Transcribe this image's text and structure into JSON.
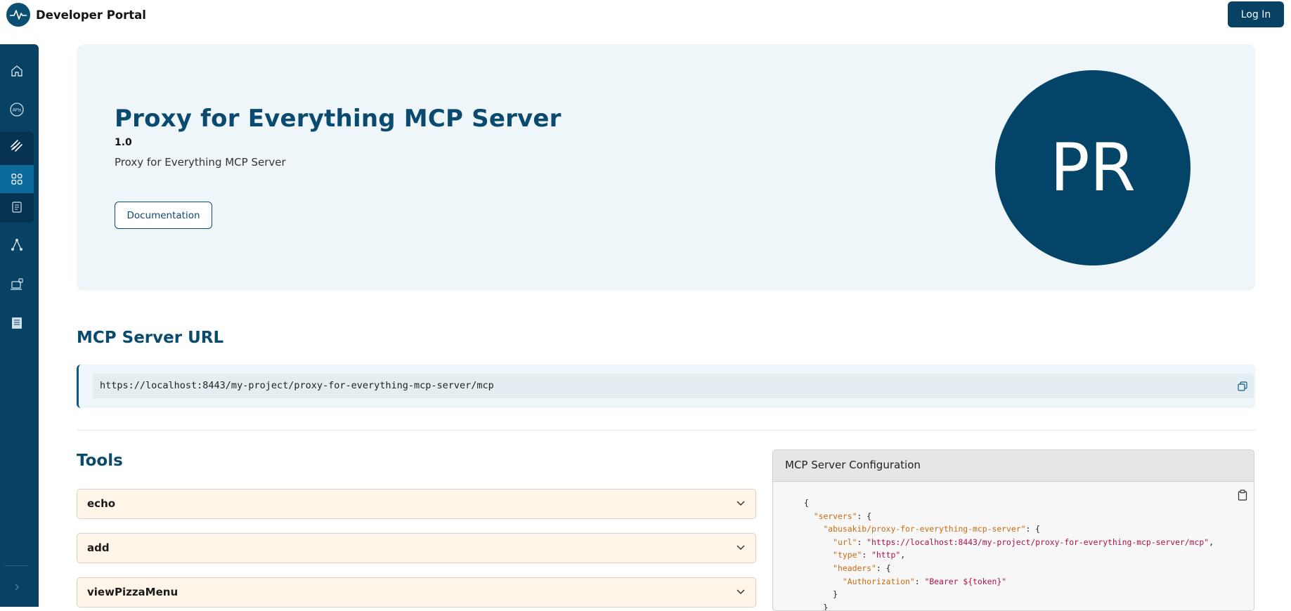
{
  "header": {
    "app_title": "Developer Portal",
    "login_label": "Log In"
  },
  "sidebar": {
    "items": [
      {
        "icon": "home-icon"
      },
      {
        "icon": "apis-icon",
        "label": "APIs"
      },
      {
        "icon": "mcp-icon"
      },
      {
        "icon": "grid-icon"
      },
      {
        "icon": "document-icon"
      },
      {
        "icon": "flow-icon"
      },
      {
        "icon": "applications-icon"
      },
      {
        "icon": "docs-icon"
      }
    ],
    "expand_icon": "chevron-right-icon"
  },
  "hero": {
    "title": "Proxy for Everything MCP Server",
    "version": "1.0",
    "description": "Proxy for Everything MCP Server",
    "doc_button": "Documentation",
    "avatar_initials": "PR"
  },
  "url_section": {
    "title": "MCP Server URL",
    "url": "https://localhost:8443/my-project/proxy-for-everything-mcp-server/mcp"
  },
  "tools": {
    "title": "Tools",
    "items": [
      {
        "name": "echo"
      },
      {
        "name": "add"
      },
      {
        "name": "viewPizzaMenu"
      }
    ]
  },
  "config": {
    "title": "MCP Server Configuration",
    "json": {
      "servers_key": "\"servers\"",
      "server_key": "\"abusakib/proxy-for-everything-mcp-server\"",
      "url_key": "\"url\"",
      "url_val": "\"https://localhost:8443/my-project/proxy-for-everything-mcp-server/mcp\"",
      "type_key": "\"type\"",
      "type_val": "\"http\"",
      "headers_key": "\"headers\"",
      "auth_key": "\"Authorization\"",
      "auth_val": "\"Bearer ${token}\""
    }
  },
  "colors": {
    "primary": "#074265",
    "accent": "#0c6b9c",
    "hero_bg": "#eff6fa",
    "tool_bg": "#fff5e8"
  }
}
